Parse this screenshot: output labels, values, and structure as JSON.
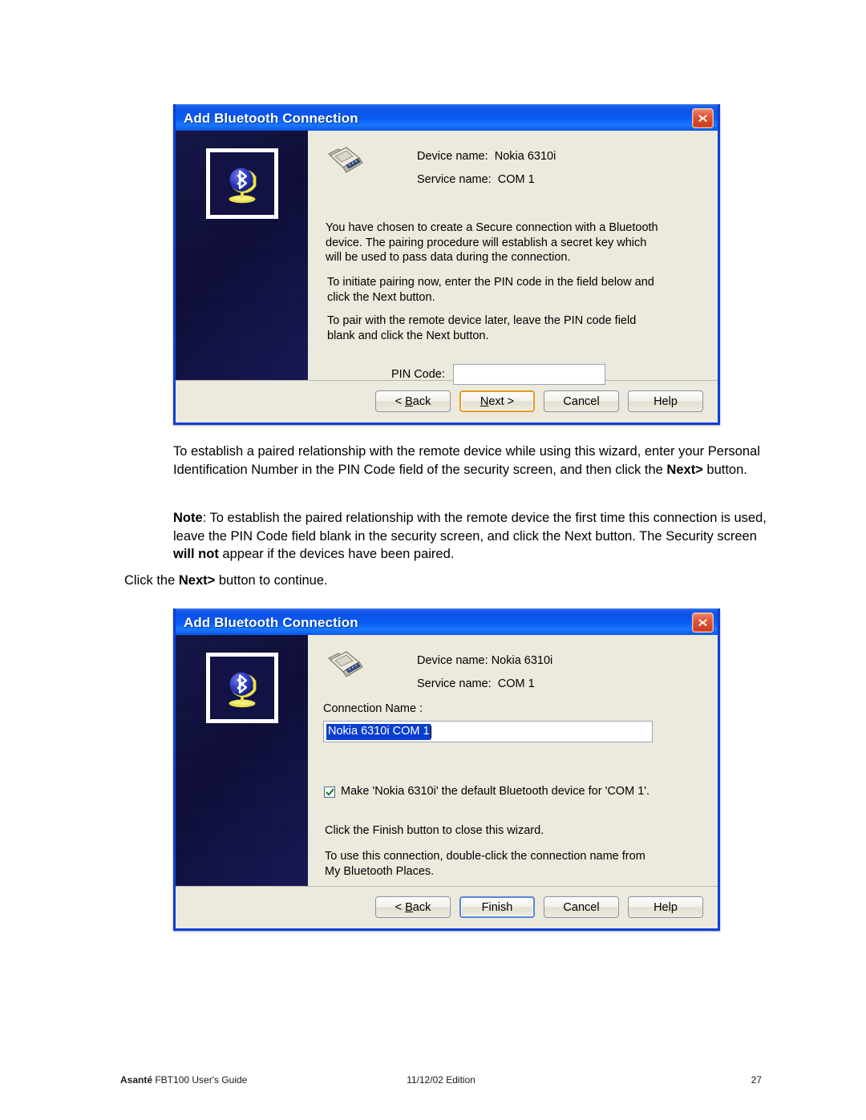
{
  "page": {
    "footer": {
      "left_bold": "Asanté",
      "left_rest": " FBT100 User's Guide",
      "center": "11/12/02 Edition",
      "page_number": "27"
    }
  },
  "dialog_security": {
    "title": "Add Bluetooth Connection",
    "close_icon": "close-icon",
    "nav_icon": "bluetooth-globe-icon",
    "service_icon": "serial-port-icon",
    "device_name_label": "Device name:",
    "device_name_value": "Nokia 6310i",
    "service_name_label": "Service name:",
    "service_name_value": "COM 1",
    "paragraph_1": "You have chosen to create a Secure connection with a Bluetooth device.  The pairing procedure will establish a secret key which will be used to pass data during the connection.",
    "paragraph_2": "To initiate pairing now, enter the PIN code in the field below and click the Next button.",
    "paragraph_3": "To pair with the remote device later, leave the PIN code field blank and click the Next button.",
    "pin_label": "PIN Code:",
    "pin_value": "",
    "pin_placeholder": "",
    "buttons": {
      "back": "< Back",
      "back_accel": "B",
      "next": "Next >",
      "next_accel": "N",
      "cancel": "Cancel",
      "help": "Help"
    },
    "accent_default_button": "#e79a22"
  },
  "prose_1": {
    "line_a": "To establish a paired relationship with the remote device while using this wizard, enter your Personal Identification Number in the PIN Code field of the security screen, and then click the ",
    "bold_a": "Next>",
    "line_b": " button."
  },
  "prose_note": {
    "bold_lead": "Note",
    "text_a": ": To establish the paired relationship with the remote device the first time this connection is used, leave the PIN Code field blank in the security screen, and click the Next button. The Security screen ",
    "bold_b": "will not",
    "text_c": " appear if the devices have been paired."
  },
  "prose_click": {
    "text_a": "Click the ",
    "bold_b": "Next>",
    "text_c": " button to continue."
  },
  "dialog_finish": {
    "title": "Add Bluetooth Connection",
    "close_icon": "close-icon",
    "nav_icon": "bluetooth-globe-icon",
    "service_icon": "serial-port-icon",
    "device_name_label": "Device name:",
    "device_name_value": "Nokia 6310i",
    "service_name_label": "Service name:",
    "service_name_value": "COM 1",
    "connection_name_label": "Connection Name :",
    "connection_name_value": "Nokia 6310i COM 1",
    "checkbox_checked": true,
    "checkbox_label": "Make 'Nokia 6310i' the default Bluetooth device for 'COM 1'.",
    "paragraph_1": "Click the Finish button to close this wizard.",
    "paragraph_2": "To use this connection, double-click the connection name from My Bluetooth Places.",
    "buttons": {
      "back": "< Back",
      "back_accel": "B",
      "finish": "Finish",
      "cancel": "Cancel",
      "help": "Help"
    },
    "accent_default_button": "#5a84d8"
  }
}
